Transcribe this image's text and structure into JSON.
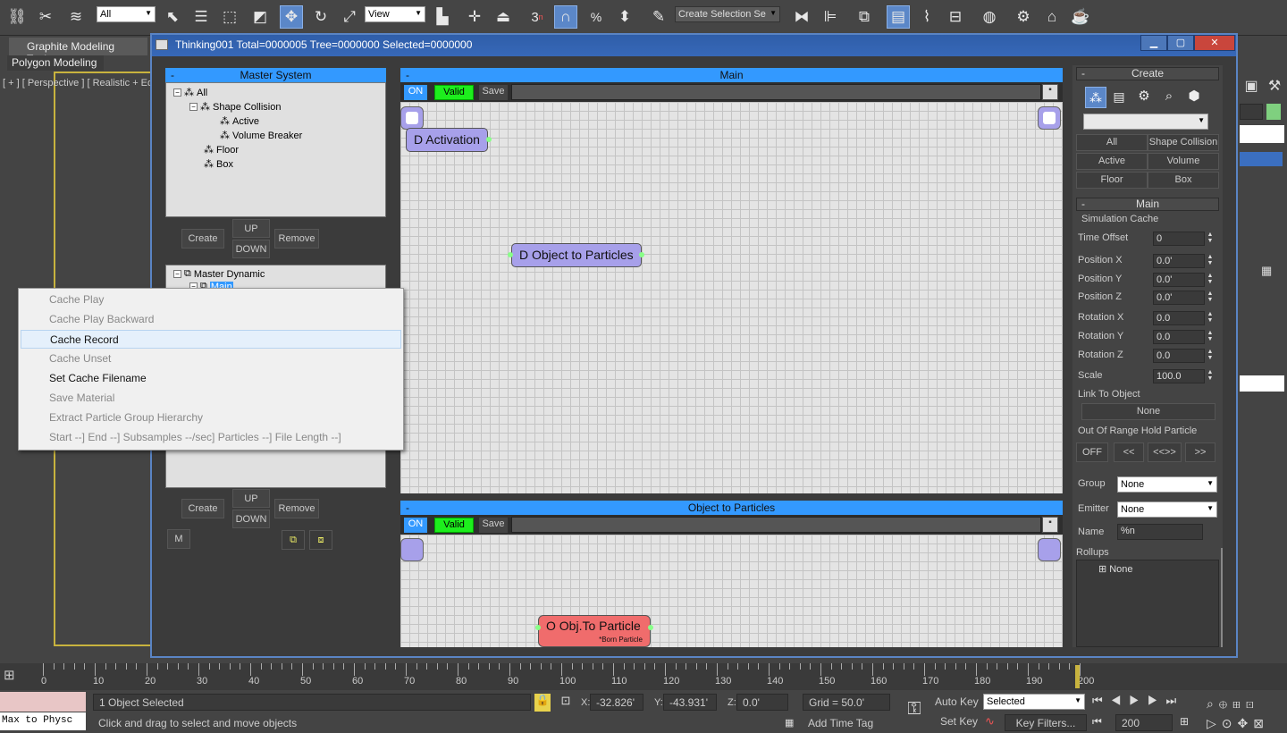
{
  "toolbar": {
    "filter_combo": "All",
    "view_combo": "View",
    "selection_set_combo": "Create Selection Se",
    "snap_label": "3"
  },
  "ribbon": {
    "tab": "Graphite Modeling Tools",
    "sub": "Polygon Modeling"
  },
  "viewport": {
    "label": "[ + ] [ Perspective ] [ Realistic + Ed"
  },
  "window": {
    "title": "Thinking001  Total=0000005  Tree=0000000  Selected=0000000",
    "min": "▁",
    "max": "▢",
    "close": "✕"
  },
  "master_system": {
    "header": "Master System",
    "tree": [
      {
        "label": "All"
      },
      {
        "label": "Shape Collision"
      },
      {
        "label": "Active"
      },
      {
        "label": "Volume Breaker"
      },
      {
        "label": "Floor"
      },
      {
        "label": "Box"
      }
    ],
    "buttons": {
      "create": "Create",
      "up": "UP",
      "down": "DOWN",
      "remove": "Remove"
    }
  },
  "master_dynamic": {
    "tree": [
      {
        "label": "Master Dynamic"
      },
      {
        "label": "Main"
      }
    ],
    "buttons": {
      "create": "Create",
      "up": "UP",
      "down": "DOWN",
      "remove": "Remove",
      "m": "M"
    }
  },
  "context_menu": [
    {
      "label": "Cache Play",
      "enabled": false
    },
    {
      "label": "Cache Play Backward",
      "enabled": false
    },
    {
      "label": "Cache Record",
      "enabled": true,
      "highlighted": true
    },
    {
      "label": "Cache Unset",
      "enabled": false
    },
    {
      "label": "Set Cache Filename",
      "enabled": true
    },
    {
      "label": "Save Material",
      "enabled": false
    },
    {
      "label": "Extract Particle Group Hierarchy",
      "enabled": false
    },
    {
      "label": "Start --]  End --]  Subsamples --/sec]  Particles --]  File Length --]",
      "enabled": false
    }
  ],
  "main_graph": {
    "header": "Main",
    "on": "ON",
    "valid": "Valid",
    "save": "Save",
    "nodes": {
      "activation": "D Activation",
      "obj_to_particles": "D Object to Particles"
    }
  },
  "otp_graph": {
    "header": "Object to Particles",
    "on": "ON",
    "valid": "Valid",
    "save": "Save",
    "nodes": {
      "obj_to_particle": "O Obj.To Particle",
      "sub": "*Born Particle"
    }
  },
  "create_rollout": {
    "header": "Create",
    "buttons": [
      "All",
      "Shape Collision",
      "Active",
      "Volume Breaker",
      "Floor",
      "Box"
    ]
  },
  "main_rollout": {
    "header": "Main",
    "group": "Simulation Cache",
    "fields": [
      {
        "label": "Time Offset",
        "value": "0"
      },
      {
        "label": "Position X",
        "value": "0.0'"
      },
      {
        "label": "Position Y",
        "value": "0.0'"
      },
      {
        "label": "Position Z",
        "value": "0.0'"
      },
      {
        "label": "Rotation X",
        "value": "0.0"
      },
      {
        "label": "Rotation Y",
        "value": "0.0"
      },
      {
        "label": "Rotation Z",
        "value": "0.0"
      },
      {
        "label": "Scale",
        "value": "100.0"
      }
    ],
    "link_label": "Link To Object",
    "link_value": "None",
    "oor_label": "Out Of Range Hold Particle",
    "oor_buttons": [
      "OFF",
      "<<",
      "<<>>",
      ">>"
    ],
    "group_label": "Group",
    "group_value": "None",
    "emitter_label": "Emitter",
    "emitter_value": "None",
    "name_label": "Name",
    "name_value": "%n",
    "rollups_label": "Rollups",
    "rollups_value": "None"
  },
  "timeline": {
    "ticks": [
      "0",
      "10",
      "20",
      "30",
      "40",
      "50",
      "60",
      "70",
      "80",
      "90",
      "100",
      "110",
      "120",
      "130",
      "140",
      "150",
      "160",
      "170",
      "180",
      "190",
      "200"
    ]
  },
  "status": {
    "script_listener": "Max to Physc",
    "selected": "1 Object Selected",
    "prompt": "Click and drag to select and move objects",
    "x_label": "X:",
    "x": "-32.826'",
    "y_label": "Y:",
    "y": "-43.931'",
    "z_label": "Z:",
    "z": "0.0'",
    "grid": "Grid = 50.0'",
    "add_time_tag": "Add Time Tag",
    "auto_key": "Auto Key",
    "set_key": "Set Key",
    "key_mode": "Selected",
    "key_filters": "Key Filters...",
    "frame": "200"
  }
}
